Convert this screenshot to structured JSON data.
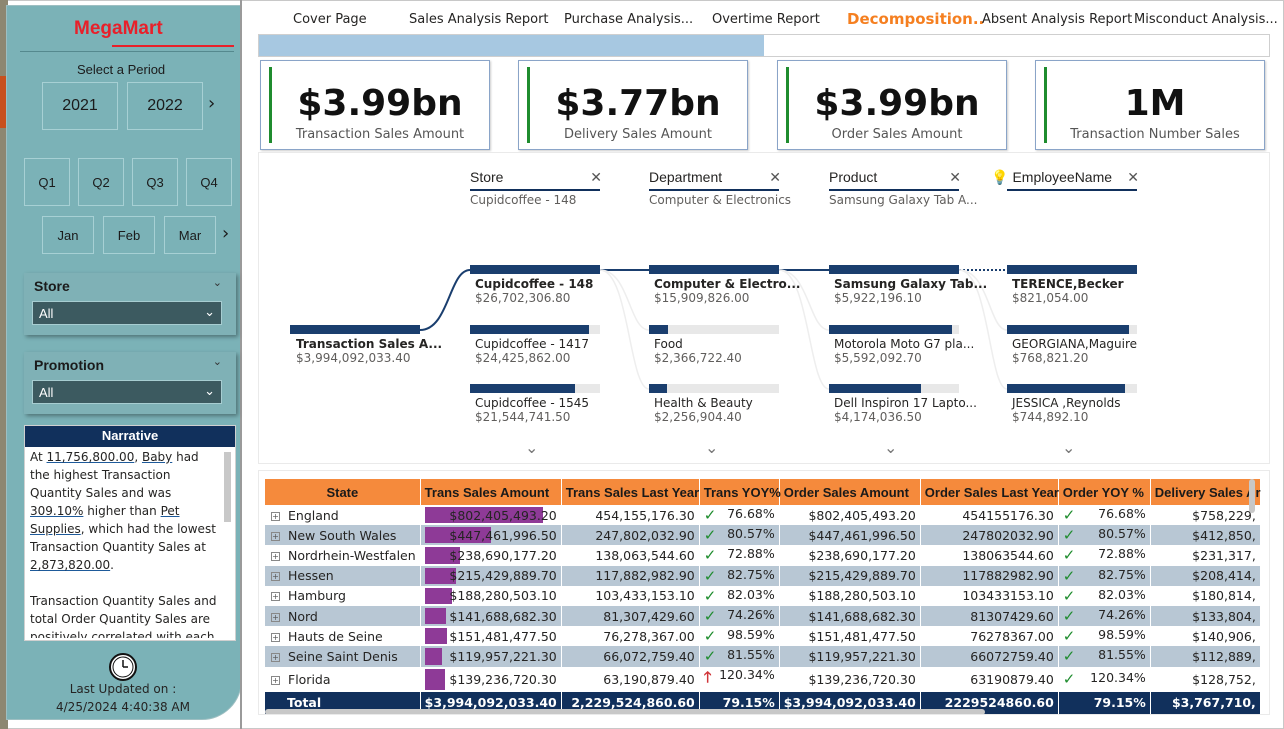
{
  "brand": {
    "name": "MegaMart"
  },
  "period": {
    "label": "Select a Period",
    "years": [
      "2021",
      "2022"
    ],
    "quarters": [
      "Q1",
      "Q2",
      "Q3",
      "Q4"
    ],
    "months": [
      "Jan",
      "Feb",
      "Mar"
    ]
  },
  "filters": {
    "store": {
      "title": "Store",
      "value": "All"
    },
    "promotion": {
      "title": "Promotion",
      "value": "All"
    }
  },
  "narrative": {
    "title": "Narrative",
    "p1_a": "At ",
    "p1_v1": "11,756,800.00",
    ", ": "",
    "p1_b": ", ",
    "p1_v2": "Baby",
    "p1_c": " had the highest Transaction Quantity Sales and was ",
    "p1_v3": "309.10%",
    "p1_d": " higher than ",
    "p1_v4": "Pet Supplies",
    "p1_e": ", which had the lowest Transaction Quantity Sales at ",
    "p1_v5": "2,873,820.00",
    "p1_f": ".",
    "p2": "Transaction Quantity Sales and total Order Quantity Sales are positively correlated with each other"
  },
  "updated": {
    "label": "Last Updated on :",
    "value": "4/25/2024 4:40:38 AM"
  },
  "tabs": [
    "Cover Page",
    "Sales Analysis Report",
    "Purchase Analysis...",
    "Overtime Report",
    "Decomposition..",
    "Absent Analysis Report",
    "Misconduct Analysis..."
  ],
  "active_tab": "Decomposition..",
  "progress": 0.5,
  "cards": [
    {
      "value": "$3.99bn",
      "caption": "Transaction Sales Amount"
    },
    {
      "value": "$3.77bn",
      "caption": "Delivery Sales Amount"
    },
    {
      "value": "$3.99bn",
      "caption": "Order Sales Amount"
    },
    {
      "value": "1M",
      "caption": "Transaction Number Sales"
    }
  ],
  "decomp": {
    "headers": [
      {
        "title": "Store",
        "sub": "Cupidcoffee - 148"
      },
      {
        "title": "Department",
        "sub": "Computer & Electronics"
      },
      {
        "title": "Product",
        "sub": "Samsung Galaxy Tab A..."
      },
      {
        "title": "EmployeeName",
        "sub": ""
      }
    ],
    "root": {
      "label": "Transaction Sales A...",
      "value": "$3,994,092,033.40"
    },
    "levels": [
      [
        {
          "label": "Cupidcoffee - 148",
          "value": "$26,702,306.80",
          "frac": 1.0
        },
        {
          "label": "Cupidcoffee - 1417",
          "value": "$24,425,862.00",
          "frac": 0.915
        },
        {
          "label": "Cupidcoffee - 1545",
          "value": "$21,544,741.50",
          "frac": 0.807
        }
      ],
      [
        {
          "label": "Computer & Electro...",
          "value": "$15,909,826.00",
          "frac": 1.0
        },
        {
          "label": "Food",
          "value": "$2,366,722.40",
          "frac": 0.149
        },
        {
          "label": "Health & Beauty",
          "value": "$2,256,904.40",
          "frac": 0.142
        }
      ],
      [
        {
          "label": "Samsung Galaxy Tab...",
          "value": "$5,922,196.10",
          "frac": 1.0
        },
        {
          "label": "Motorola Moto G7 pla...",
          "value": "$5,592,092.70",
          "frac": 0.944
        },
        {
          "label": "Dell Inspiron 17 Lapto...",
          "value": "$4,174,036.50",
          "frac": 0.705
        }
      ],
      [
        {
          "label": "TERENCE,Becker",
          "value": "$821,054.00",
          "frac": 1.0
        },
        {
          "label": "GEORGIANA,Maguire",
          "value": "$768,821.20",
          "frac": 0.936
        },
        {
          "label": "JESSICA ,Reynolds",
          "value": "$744,892.10",
          "frac": 0.907
        }
      ]
    ]
  },
  "table": {
    "columns": [
      "State",
      "Trans Sales Amount",
      "Trans Sales Last Year",
      "Trans YOY%",
      "Order Sales Amount",
      "Order Sales Last Year",
      "Order YOY %",
      "Delivery Sales Ar"
    ],
    "rows": [
      {
        "state": "England",
        "tsa": "$802,405,493.20",
        "frac": 1.0,
        "tsly": "454,155,176.30",
        "icon": "check",
        "tyoy": "76.68%",
        "osa": "$802,405,493.20",
        "osly": "454155176.30",
        "oyoy": "76.68%",
        "dsa": "$758,229,"
      },
      {
        "state": "New South Wales",
        "tsa": "$447,461,996.50",
        "frac": 0.558,
        "tsly": "247,802,032.90",
        "icon": "check",
        "tyoy": "80.57%",
        "osa": "$447,461,996.50",
        "osly": "247802032.90",
        "oyoy": "80.57%",
        "dsa": "$412,850,"
      },
      {
        "state": "Nordrhein-Westfalen",
        "tsa": "$238,690,177.20",
        "frac": 0.297,
        "tsly": "138,063,544.60",
        "icon": "check",
        "tyoy": "72.88%",
        "osa": "$238,690,177.20",
        "osly": "138063544.60",
        "oyoy": "72.88%",
        "dsa": "$231,317,"
      },
      {
        "state": "Hessen",
        "tsa": "$215,429,889.70",
        "frac": 0.268,
        "tsly": "117,882,982.90",
        "icon": "check",
        "tyoy": "82.75%",
        "osa": "$215,429,889.70",
        "osly": "117882982.90",
        "oyoy": "82.75%",
        "dsa": "$208,414,"
      },
      {
        "state": "Hamburg",
        "tsa": "$188,280,503.10",
        "frac": 0.235,
        "tsly": "103,433,153.10",
        "icon": "check",
        "tyoy": "82.03%",
        "osa": "$188,280,503.10",
        "osly": "103433153.10",
        "oyoy": "82.03%",
        "dsa": "$180,814,"
      },
      {
        "state": "Nord",
        "tsa": "$141,688,682.30",
        "frac": 0.177,
        "tsly": "81,307,429.60",
        "icon": "check",
        "tyoy": "74.26%",
        "osa": "$141,688,682.30",
        "osly": "81307429.60",
        "oyoy": "74.26%",
        "dsa": "$133,804,"
      },
      {
        "state": "Hauts de Seine",
        "tsa": "$151,481,477.50",
        "frac": 0.189,
        "tsly": "76,278,367.00",
        "icon": "check",
        "tyoy": "98.59%",
        "osa": "$151,481,477.50",
        "osly": "76278367.00",
        "oyoy": "98.59%",
        "dsa": "$140,906,"
      },
      {
        "state": "Seine Saint Denis",
        "tsa": "$119,957,221.30",
        "frac": 0.149,
        "tsly": "66,072,759.40",
        "icon": "check",
        "tyoy": "81.55%",
        "osa": "$119,957,221.30",
        "osly": "66072759.40",
        "oyoy": "81.55%",
        "dsa": "$112,889,"
      },
      {
        "state": "Florida",
        "tsa": "$139,236,720.30",
        "frac": 0.173,
        "tsly": "63,190,879.40",
        "icon": "up",
        "tyoy": "120.34%",
        "osa": "$139,236,720.30",
        "osly": "63190879.40",
        "oyoy": "120.34%",
        "dsa": "$128,752,"
      }
    ],
    "total": {
      "state": "Total",
      "tsa": "$3,994,092,033.40",
      "tsly": "2,229,524,860.60",
      "tyoy": "79.15%",
      "osa": "$3,994,092,033.40",
      "osly": "2229524860.60",
      "oyoy": "79.15%",
      "dsa": "$3,767,710,"
    }
  },
  "colors": {
    "accent": "#f57f20",
    "navy": "#11305c",
    "bar": "#8e3a97",
    "good": "#1f8c2e",
    "bad": "#d13438"
  }
}
